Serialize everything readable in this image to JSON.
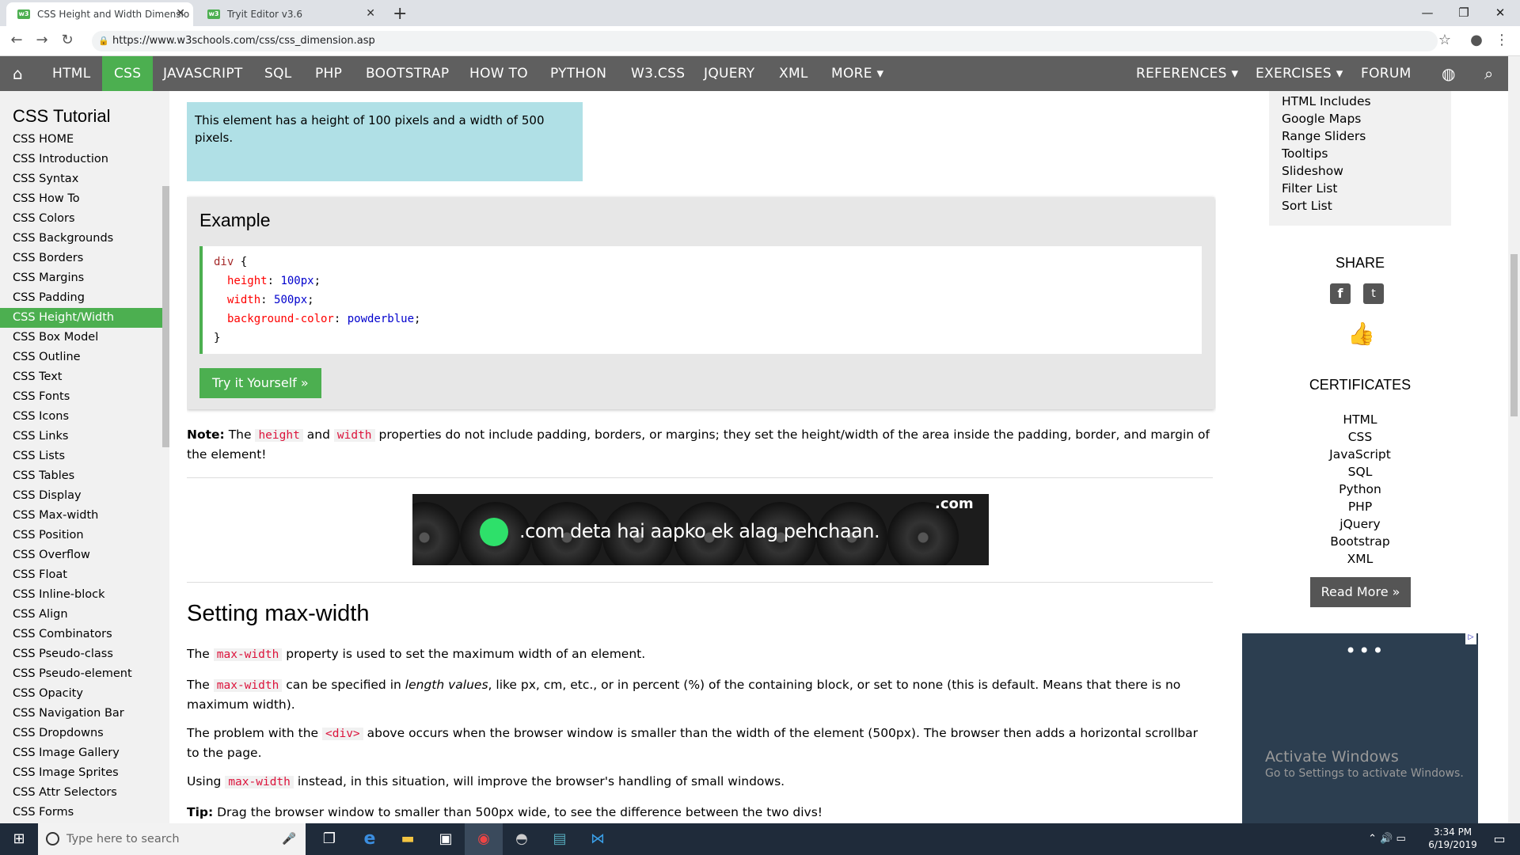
{
  "browser": {
    "tabs": [
      {
        "label": "CSS Height and Width Dimensio",
        "favicon": "w3"
      },
      {
        "label": "Tryit Editor v3.6",
        "favicon": "w3"
      }
    ],
    "url": "https://www.w3schools.com/css/css_dimension.asp"
  },
  "topnav": {
    "items": [
      "HTML",
      "CSS",
      "JAVASCRIPT",
      "SQL",
      "PHP",
      "BOOTSTRAP",
      "HOW TO",
      "PYTHON",
      "W3.CSS",
      "JQUERY",
      "XML",
      "MORE ▾"
    ],
    "right": [
      "REFERENCES ▾",
      "EXERCISES ▾",
      "FORUM"
    ],
    "active": "CSS",
    "active_color": "#4caf50"
  },
  "sidebar": {
    "title": "CSS Tutorial",
    "items": [
      "CSS HOME",
      "CSS Introduction",
      "CSS Syntax",
      "CSS How To",
      "CSS Colors",
      "CSS Backgrounds",
      "CSS Borders",
      "CSS Margins",
      "CSS Padding",
      "CSS Height/Width",
      "CSS Box Model",
      "CSS Outline",
      "CSS Text",
      "CSS Fonts",
      "CSS Icons",
      "CSS Links",
      "CSS Lists",
      "CSS Tables",
      "CSS Display",
      "CSS Max-width",
      "CSS Position",
      "CSS Overflow",
      "CSS Float",
      "CSS Inline-block",
      "CSS Align",
      "CSS Combinators",
      "CSS Pseudo-class",
      "CSS Pseudo-element",
      "CSS Opacity",
      "CSS Navigation Bar",
      "CSS Dropdowns",
      "CSS Image Gallery",
      "CSS Image Sprites",
      "CSS Attr Selectors",
      "CSS Forms"
    ],
    "active": "CSS Height/Width"
  },
  "main": {
    "demo_text": "This element has a height of 100 pixels and a width of 500 pixels.",
    "example_title": "Example",
    "code": {
      "selector": "div",
      "lines": [
        {
          "prop": "height",
          "val": "100px"
        },
        {
          "prop": "width",
          "val": "500px"
        },
        {
          "prop": "background-color",
          "val": "powderblue"
        }
      ]
    },
    "try_button": "Try it Yourself »",
    "note_label": "Note:",
    "note_the": "The",
    "note_kw1": "height",
    "note_and": "and",
    "note_kw2": "width",
    "note_rest": "properties do not include padding, borders, or margins; they set the height/width of the area inside the padding, border, and margin of the element!",
    "ad_text": ".com deta hai aapko ek alag pehchaan.",
    "ad_brand": ".com",
    "section_title": "Setting max-width",
    "p1_a": "The",
    "p1_kw": "max-width",
    "p1_b": "property is used to set the maximum width of an element.",
    "p2_a": "The",
    "p2_kw": "max-width",
    "p2_b": "can be specified in",
    "p2_em": "length values",
    "p2_c": ", like px, cm, etc., or in percent (%) of the containing block, or set to none (this is default. Means that there is no maximum width).",
    "p3_a": "The problem with the",
    "p3_kw": "<div>",
    "p3_b": "above occurs when the browser window is smaller than the width of the element (500px). The browser then adds a horizontal scrollbar to the page.",
    "p4_a": "Using",
    "p4_kw": "max-width",
    "p4_b": "instead, in this situation, will improve the browser's handling of small windows.",
    "tip_label": "Tip:",
    "tip_text": "Drag the browser window to smaller than 500px wide, to see the difference between the two divs!"
  },
  "right": {
    "links": [
      "HTML Includes",
      "Google Maps",
      "Range Sliders",
      "Tooltips",
      "Slideshow",
      "Filter List",
      "Sort List"
    ],
    "share_title": "SHARE",
    "cert_title": "CERTIFICATES",
    "certs": [
      "HTML",
      "CSS",
      "JavaScript",
      "SQL",
      "Python",
      "PHP",
      "jQuery",
      "Bootstrap",
      "XML"
    ],
    "read_more": "Read More »",
    "activate_1": "Activate Windows",
    "activate_2": "Go to Settings to activate Windows."
  },
  "taskbar": {
    "search_placeholder": "Type here to search",
    "time": "3:34 PM",
    "date": "6/19/2019"
  }
}
